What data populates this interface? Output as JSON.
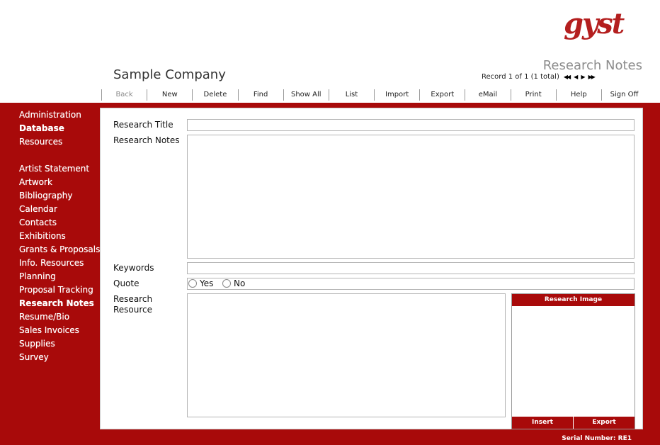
{
  "header": {
    "logo_text": "gyst",
    "module_title": "Research Notes",
    "company": "Sample Company",
    "record_status": "Record 1 of 1 (1 total)",
    "nav_buttons": [
      {
        "name": "first-record-icon",
        "glyph": "◀◀"
      },
      {
        "name": "prev-record-icon",
        "glyph": "◀"
      },
      {
        "name": "next-record-icon",
        "glyph": "▶"
      },
      {
        "name": "last-record-icon",
        "glyph": "▶▶"
      }
    ]
  },
  "toolbar": [
    "Back",
    "New",
    "Delete",
    "Find",
    "Show All",
    "List",
    "Import",
    "Export",
    "eMail",
    "Print",
    "Help",
    "Sign Off"
  ],
  "sidebar": {
    "top": [
      "Administration",
      "Database",
      "Resources"
    ],
    "modules": [
      "Artist Statement",
      "Artwork",
      "Bibliography",
      "Calendar",
      "Contacts",
      "Exhibitions",
      "Grants & Proposals",
      "Info. Resources",
      "Planning",
      "Proposal Tracking",
      "Research Notes",
      "Resume/Bio",
      "Sales Invoices",
      "Supplies",
      "Survey"
    ]
  },
  "form": {
    "research_title_label": "Research Title",
    "research_notes_label": "Research Notes",
    "keywords_label": "Keywords",
    "quote_label": "Quote",
    "quote_yes": "Yes",
    "quote_no": "No",
    "research_resource_label": "Research\nResource",
    "research_image_label": "Research Image",
    "insert_label": "Insert",
    "export_label": "Export"
  },
  "footer": {
    "serial": "Serial Number: RE1"
  },
  "colors": {
    "brand": "#a80a0a",
    "logo": "#b41f1f"
  }
}
